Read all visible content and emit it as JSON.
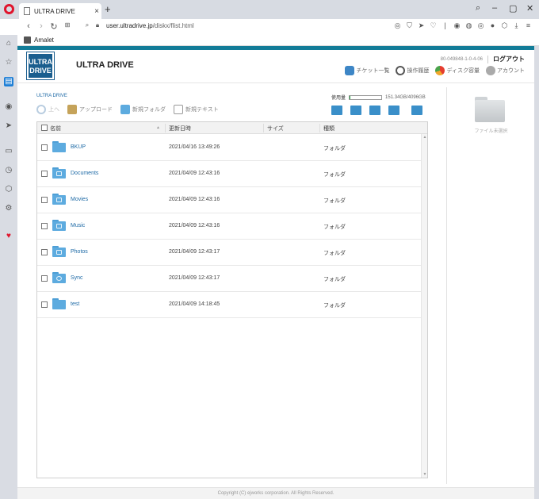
{
  "browser": {
    "tab_title": "ULTRA DRIVE",
    "url_domain": "user.ultradrive.jp",
    "url_path": "/diskx/flist.html",
    "bookmark": "Amalet"
  },
  "header": {
    "logo_line1": "ULTRA",
    "logo_line2": "DRIVE",
    "title": "ULTRA DRIVE",
    "user": "80-049848-1-0-4-06",
    "logout": "ログアウト",
    "links": [
      "チケット一覧",
      "操作履歴",
      "ディスク容量",
      "アカウント"
    ]
  },
  "breadcrumb": "ULTRA DRIVE",
  "toolbar": {
    "up": "上へ",
    "upload": "アップロード",
    "new_folder": "新規フォルダ",
    "new_text": "新規テキスト"
  },
  "usage": {
    "label": "使用量",
    "value": "151.34GB/4096GB",
    "fraction": 0.037
  },
  "table": {
    "headers": [
      "名前",
      "更新日時",
      "サイズ",
      "種類"
    ],
    "rows": [
      {
        "name": "BKUP",
        "date": "2021/04/16 13:49:26",
        "kind": "フォルダ"
      },
      {
        "name": "Documents",
        "date": "2021/04/09 12:43:16",
        "kind": "フォルダ"
      },
      {
        "name": "Movies",
        "date": "2021/04/09 12:43:16",
        "kind": "フォルダ"
      },
      {
        "name": "Music",
        "date": "2021/04/09 12:43:16",
        "kind": "フォルダ"
      },
      {
        "name": "Photos",
        "date": "2021/04/09 12:43:17",
        "kind": "フォルダ"
      },
      {
        "name": "Sync",
        "date": "2021/04/09 12:43:17",
        "kind": "フォルダ"
      },
      {
        "name": "test",
        "date": "2021/04/09 14:18:45",
        "kind": "フォルダ"
      }
    ]
  },
  "preview": {
    "no_selection": "ファイル未選択"
  },
  "footer": "Copyright (C) ejworks corporation. All Rights Reserved.",
  "colors": {
    "accent": "#127c98",
    "link": "#1e6aa6",
    "folder": "#5dabdf"
  }
}
